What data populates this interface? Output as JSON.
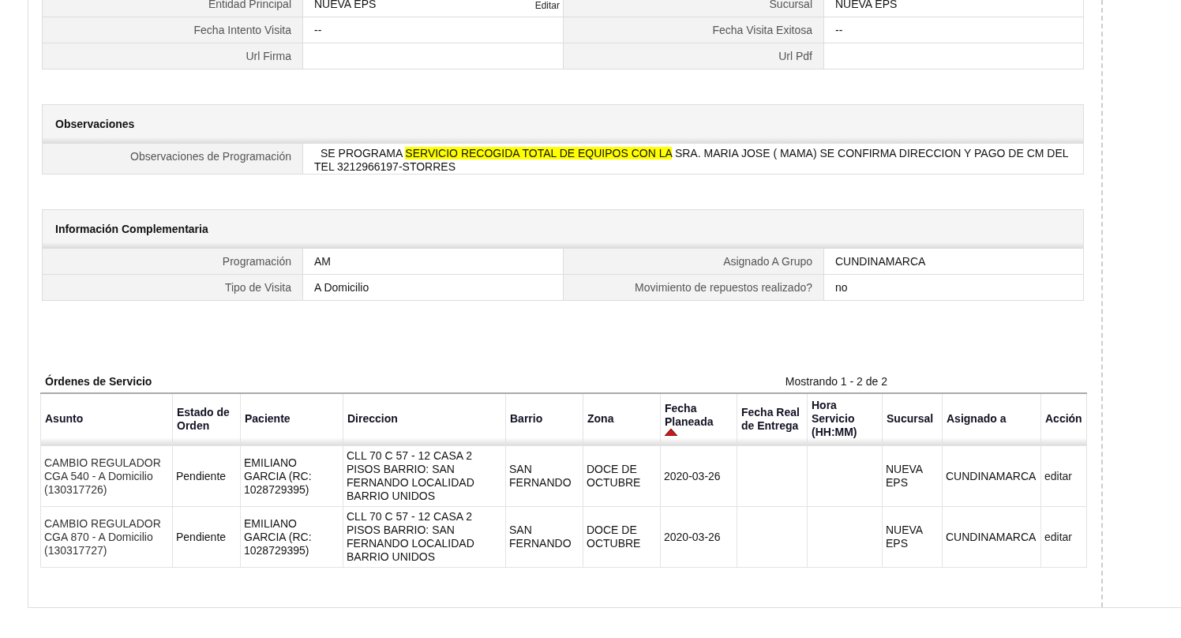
{
  "details": {
    "edit_link": "Editar",
    "rows": [
      [
        {
          "label": "Entidad Principal",
          "value": "NUEVA EPS"
        },
        {
          "label": "Sucursal",
          "value": "NUEVA EPS"
        }
      ],
      [
        {
          "label": "Fecha Intento Visita",
          "value": "--"
        },
        {
          "label": "Fecha Visita Exitosa",
          "value": "--"
        }
      ],
      [
        {
          "label": "Url Firma"
        },
        {
          "label": "Url Pdf"
        }
      ]
    ]
  },
  "observaciones": {
    "title": "Observaciones",
    "label": "Observaciones de Programación",
    "parts": [
      {
        "text": "SE PROGRAMA ",
        "highlighted": false
      },
      {
        "text": "SERVICIO RECOGIDA TOTAL DE EQUIPOS CON LA",
        "highlighted": true
      },
      {
        "text": " SRA. MARIA JOSE ( MAMA) SE CONFIRMA DIRECCION Y PAGO DE CM DEL TEL 3212966197-STORRES",
        "highlighted": false
      }
    ]
  },
  "informacion": {
    "title": "Información Complementaria",
    "rows": [
      [
        {
          "label": "Programación",
          "value": "AM"
        },
        {
          "label": "Asignado A Grupo",
          "value": "CUNDINAMARCA"
        }
      ],
      [
        {
          "label": "Tipo de Visita",
          "value": "A Domicilio"
        },
        {
          "label": "Movimiento de repuestos realizado?",
          "value": "no"
        }
      ]
    ]
  },
  "ordenes": {
    "title": "Órdenes de Servicio",
    "paging": "Mostrando 1 - 2 de 2",
    "columns": [
      {
        "label": "Asunto",
        "sorted": false,
        "kind": "text"
      },
      {
        "label": "Estado de Orden",
        "sorted": false,
        "kind": "text"
      },
      {
        "label": "Paciente",
        "sorted": false,
        "kind": "text"
      },
      {
        "label": "Direccion",
        "sorted": false,
        "kind": "text"
      },
      {
        "label": "Barrio",
        "sorted": false,
        "kind": "text"
      },
      {
        "label": "Zona",
        "sorted": false,
        "kind": "text"
      },
      {
        "label": "Fecha Planeada",
        "sorted": true,
        "kind": "text"
      },
      {
        "label": "Fecha Real de Entrega",
        "sorted": false,
        "kind": "text"
      },
      {
        "label": "Hora Servicio (HH:MM)",
        "sorted": false,
        "kind": "text"
      },
      {
        "label": "Sucursal",
        "sorted": false,
        "kind": "text"
      },
      {
        "label": "Asignado a",
        "sorted": false,
        "kind": "text"
      },
      {
        "label": "Acción",
        "sorted": false,
        "kind": "link"
      }
    ],
    "rows": [
      [
        "CAMBIO REGULADOR CGA 540 - A Domicilio (130317726)",
        "Pendiente",
        "EMILIANO GARCIA (RC: 1028729395)",
        "CLL 70 C 57 - 12 CASA 2 PISOS BARRIO: SAN FERNANDO LOCALIDAD BARRIO UNIDOS",
        "SAN FERNANDO",
        "DOCE DE OCTUBRE",
        "2020-03-26",
        null,
        null,
        "NUEVA EPS",
        "CUNDINAMARCA",
        "editar"
      ],
      [
        "CAMBIO REGULADOR CGA 870 - A Domicilio (130317727)",
        "Pendiente",
        "EMILIANO GARCIA (RC: 1028729395)",
        "CLL 70 C 57 - 12 CASA 2 PISOS BARRIO: SAN FERNANDO LOCALIDAD BARRIO UNIDOS",
        "SAN FERNANDO",
        "DOCE DE OCTUBRE",
        "2020-03-26",
        null,
        null,
        "NUEVA EPS",
        "CUNDINAMARCA",
        "editar"
      ]
    ]
  }
}
